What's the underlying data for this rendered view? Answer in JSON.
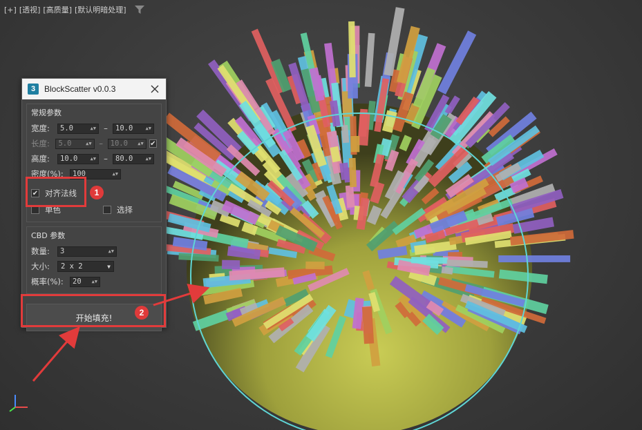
{
  "viewport": {
    "labels": [
      "[+]",
      "[透视]",
      "[高质量]",
      "[默认明暗处理]"
    ]
  },
  "dialog": {
    "title": "BlockScatter v0.0.3",
    "general": {
      "title": "常规参数",
      "width": {
        "label": "宽度:",
        "min": "5.0",
        "max": "10.0"
      },
      "length": {
        "label": "长度:",
        "min": "5.0",
        "max": "10.0"
      },
      "height": {
        "label": "高度:",
        "min": "10.0",
        "max": "80.0"
      },
      "density": {
        "label": "密度(%):",
        "value": "100"
      },
      "align_normal": {
        "label": "对齐法线",
        "checked": true
      },
      "single_color": {
        "label": "单色"
      },
      "select": {
        "label": "选择"
      }
    },
    "cbd": {
      "title": "CBD 参数",
      "count": {
        "label": "数量:",
        "value": "3"
      },
      "size": {
        "label": "大小:",
        "value": "2 x 2"
      },
      "probability": {
        "label": "概率(%):",
        "value": "20"
      }
    },
    "start_button": "开始填充!"
  },
  "annotations": {
    "badge1": "1",
    "badge2": "2"
  },
  "colors": {
    "highlight": "#e23b3b",
    "sphere": "#b5b84a",
    "ring": "#5fd5d5"
  }
}
